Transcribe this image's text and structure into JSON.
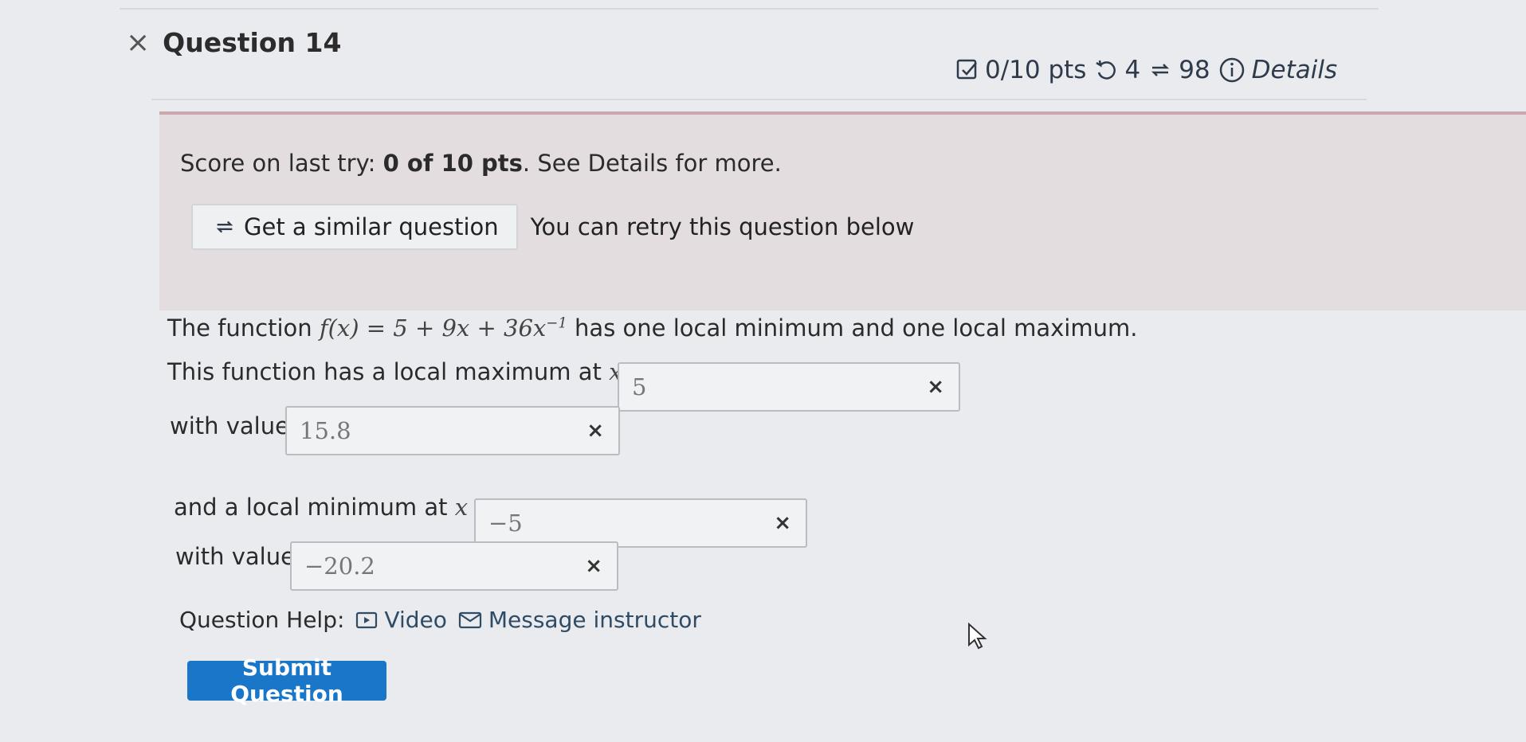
{
  "header": {
    "close_mark": "×",
    "title": "Question 14",
    "score": "0/10 pts",
    "retries": "4",
    "similar_count": "98",
    "details": "Details"
  },
  "banner": {
    "score_prefix": "Score on last try: ",
    "score_value": "0 of 10 pts",
    "score_suffix": ". See Details for more.",
    "similar_button": "Get a similar question",
    "retry_text": "You can retry this question below"
  },
  "question": {
    "intro_prefix": "The function ",
    "function_math": "f(x) = 5 + 9x + 36x",
    "exponent": "−1",
    "intro_suffix": " has one local minimum and one local maximum.",
    "max_prefix": "This function has a local maximum at ",
    "x_eq": "x =",
    "with_value": "with value",
    "min_prefix": "and a local minimum at "
  },
  "answers": {
    "max_x": "5",
    "max_value": "15.8",
    "min_x": "−5",
    "min_value": "−20.2",
    "clear_mark": "×"
  },
  "help": {
    "label": "Question Help:",
    "video": "Video",
    "message": "Message instructor"
  },
  "submit": "Submit Question",
  "colors": {
    "accent": "#1976c9",
    "banner": "#e3dde0",
    "link": "#2f4b66"
  }
}
